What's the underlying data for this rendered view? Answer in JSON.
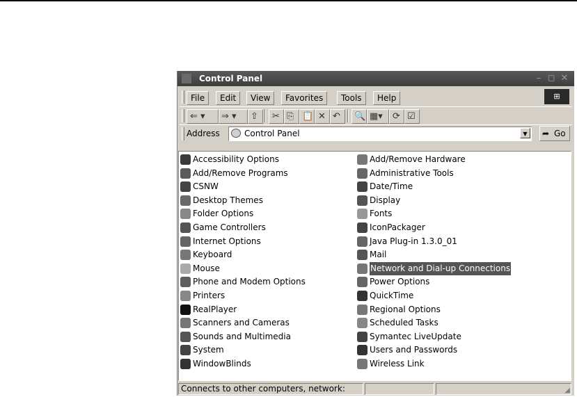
{
  "window": {
    "title": "Control Panel"
  },
  "menubar": {
    "items": [
      {
        "label": "File"
      },
      {
        "label": "Edit"
      },
      {
        "label": "View"
      },
      {
        "label": "Favorites"
      },
      {
        "label": "Tools"
      },
      {
        "label": "Help"
      }
    ]
  },
  "toolbar": {
    "buttons": [
      "back-icon",
      "forward-icon",
      "up-folder-icon",
      "cut-icon",
      "copy-icon",
      "paste-icon",
      "delete-icon",
      "undo-icon",
      "search-icon",
      "views-icon",
      "refresh-icon",
      "properties-icon"
    ]
  },
  "address": {
    "label": "Address",
    "value": "Control Panel",
    "go_label": "Go"
  },
  "items_left": [
    {
      "label": "Accessibility Options",
      "color": "#3a3a3a"
    },
    {
      "label": "Add/Remove Programs",
      "color": "#5a5a5a"
    },
    {
      "label": "CSNW",
      "color": "#444"
    },
    {
      "label": "Desktop Themes",
      "color": "#6a6a6a"
    },
    {
      "label": "Folder Options",
      "color": "#888"
    },
    {
      "label": "Game Controllers",
      "color": "#555"
    },
    {
      "label": "Internet Options",
      "color": "#666"
    },
    {
      "label": "Keyboard",
      "color": "#777"
    },
    {
      "label": "Mouse",
      "color": "#aaa"
    },
    {
      "label": "Phone and Modem Options",
      "color": "#5e5e5e"
    },
    {
      "label": "Printers",
      "color": "#888"
    },
    {
      "label": "RealPlayer",
      "color": "#111"
    },
    {
      "label": "Scanners and Cameras",
      "color": "#777"
    },
    {
      "label": "Sounds and Multimedia",
      "color": "#555"
    },
    {
      "label": "System",
      "color": "#444"
    },
    {
      "label": "WindowBlinds",
      "color": "#333"
    }
  ],
  "items_right": [
    {
      "label": "Add/Remove Hardware",
      "color": "#777"
    },
    {
      "label": "Administrative Tools",
      "color": "#666"
    },
    {
      "label": "Date/Time",
      "color": "#444"
    },
    {
      "label": "Display",
      "color": "#555"
    },
    {
      "label": "Fonts",
      "color": "#999"
    },
    {
      "label": "IconPackager",
      "color": "#444"
    },
    {
      "label": "Java Plug-in 1.3.0_01",
      "color": "#666"
    },
    {
      "label": "Mail",
      "color": "#555"
    },
    {
      "label": "Network and Dial-up Connections",
      "color": "#777",
      "selected": true
    },
    {
      "label": "Power Options",
      "color": "#666"
    },
    {
      "label": "QuickTime",
      "color": "#333"
    },
    {
      "label": "Regional Options",
      "color": "#777"
    },
    {
      "label": "Scheduled Tasks",
      "color": "#888"
    },
    {
      "label": "Symantec LiveUpdate",
      "color": "#444"
    },
    {
      "label": "Users and Passwords",
      "color": "#333"
    },
    {
      "label": "Wireless Link",
      "color": "#777"
    }
  ],
  "statusbar": {
    "text": "Connects to other computers, network:",
    "pane2": "",
    "pane3": ""
  }
}
